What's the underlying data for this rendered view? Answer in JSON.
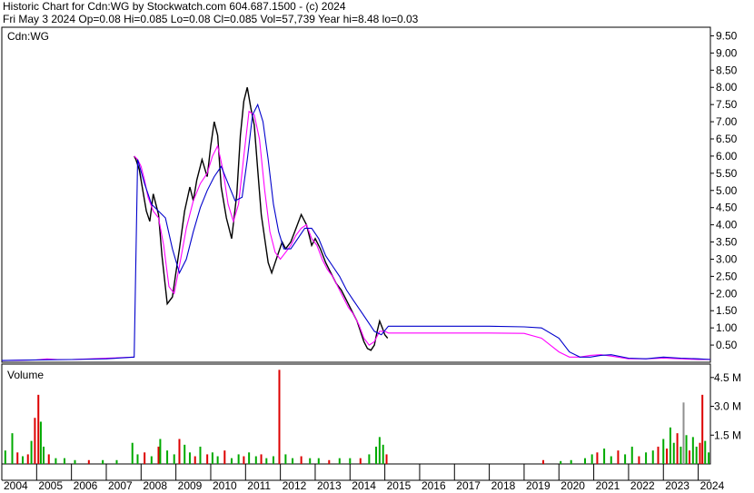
{
  "header": {
    "line1": "Historic Chart for Cdn:WG by Stockwatch.com 604.687.1500 - (c) 2024",
    "line2": "Fri May  3 2024   Op=0.08   Hi=0.085   Lo=0.08   Cl=0.085   Vol=57,739   Year hi=8.48   lo=0.03"
  },
  "chart_data": [
    {
      "type": "line",
      "title": "Cdn:WG",
      "ylim": [
        0,
        9.75
      ],
      "y_ticks": [
        "0.50",
        "1.00",
        "1.50",
        "2.00",
        "2.50",
        "3.00",
        "3.50",
        "4.00",
        "4.50",
        "5.00",
        "5.50",
        "6.00",
        "6.50",
        "7.00",
        "7.50",
        "8.00",
        "8.50",
        "9.00",
        "9.50"
      ],
      "xlim": [
        2004,
        2024.35
      ],
      "x_ticks": [
        "2004",
        "2005",
        "2006",
        "2007",
        "2008",
        "2009",
        "2010",
        "2011",
        "2012",
        "2013",
        "2014",
        "2015",
        "2016",
        "2017",
        "2018",
        "2019",
        "2020",
        "2021",
        "2022",
        "2023",
        "2024"
      ],
      "grid": false,
      "colors": {
        "price": "#000000",
        "ma_short": "#ff00ff",
        "ma_long": "#0000cc",
        "down_tick": "#cc0000"
      },
      "series": [
        {
          "x": [
            2004,
            2004.5,
            2005,
            2005.3,
            2005.6,
            2006,
            2006.5,
            2007,
            2007.8
          ],
          "values": [
            0.05,
            0.06,
            0.07,
            0.1,
            0.08,
            0.08,
            0.1,
            0.12,
            0.15
          ]
        },
        {
          "x": [
            2007.8,
            2007.85,
            2007.95,
            2008.05,
            2008.15,
            2008.25,
            2008.35,
            2008.5,
            2008.6,
            2008.75,
            2008.9,
            2009.0,
            2009.1,
            2009.25,
            2009.4,
            2009.5,
            2009.6,
            2009.75,
            2009.9,
            2010.0,
            2010.1,
            2010.2,
            2010.3,
            2010.45,
            2010.6,
            2010.75,
            2010.85,
            2010.95,
            2011.05,
            2011.15,
            2011.25,
            2011.35,
            2011.45,
            2011.55,
            2011.65,
            2011.75,
            2011.85,
            2011.95,
            2012.05,
            2012.15,
            2012.3,
            2012.45,
            2012.6,
            2012.75,
            2012.9,
            2013.0,
            2013.15,
            2013.3,
            2013.45,
            2013.6,
            2013.75,
            2013.9,
            2014.0,
            2014.1,
            2014.2,
            2014.3,
            2014.4,
            2014.5,
            2014.6,
            2014.7,
            2014.78,
            2014.85,
            2014.93,
            2015.0,
            2015.08
          ],
          "values": [
            6.0,
            5.9,
            5.6,
            5.0,
            4.4,
            4.1,
            4.9,
            4.3,
            3.1,
            1.7,
            1.9,
            2.6,
            3.3,
            4.4,
            5.1,
            4.7,
            5.3,
            5.9,
            5.4,
            6.3,
            7.0,
            6.6,
            5.1,
            4.2,
            3.6,
            4.9,
            6.6,
            7.6,
            8.0,
            7.4,
            6.9,
            5.6,
            4.3,
            3.6,
            2.9,
            2.6,
            2.9,
            3.2,
            3.5,
            3.3,
            3.5,
            3.9,
            4.3,
            4.0,
            3.4,
            3.6,
            3.3,
            2.9,
            2.6,
            2.3,
            2.1,
            1.8,
            1.6,
            1.4,
            1.2,
            0.9,
            0.6,
            0.4,
            0.35,
            0.5,
            0.9,
            1.2,
            1.0,
            0.8,
            0.7
          ]
        },
        {
          "x": [
            2007.8,
            2007.9,
            2008.0,
            2008.1,
            2008.2,
            2008.35,
            2008.5,
            2008.65,
            2008.8,
            2008.95,
            2009.1,
            2009.3,
            2009.5,
            2009.7,
            2009.9,
            2010.05,
            2010.2,
            2010.35,
            2010.5,
            2010.65,
            2010.8,
            2010.95,
            2011.1,
            2011.25,
            2011.4,
            2011.55,
            2011.7,
            2011.85,
            2012.0,
            2012.15,
            2012.3,
            2012.45,
            2012.6,
            2012.75,
            2012.9,
            2013.05,
            2013.2,
            2013.35,
            2013.5,
            2013.65,
            2013.8,
            2013.95,
            2014.1,
            2014.25,
            2014.4,
            2014.55,
            2014.7,
            2014.85,
            2015.0,
            2015.1,
            2016,
            2017,
            2018,
            2019,
            2019.5,
            2020,
            2020.3,
            2020.6,
            2020.9,
            2021.2,
            2021.5,
            2022,
            2022.5,
            2023,
            2023.5,
            2024,
            2024.35
          ],
          "values": [
            6.0,
            5.9,
            5.7,
            5.3,
            4.8,
            4.4,
            4.2,
            3.4,
            2.2,
            2.0,
            2.8,
            3.9,
            4.7,
            5.2,
            5.5,
            6.0,
            6.3,
            5.6,
            4.6,
            4.1,
            4.6,
            6.0,
            7.3,
            7.2,
            6.5,
            5.0,
            3.8,
            3.2,
            3.0,
            3.2,
            3.4,
            3.7,
            3.9,
            4.0,
            3.6,
            3.4,
            3.0,
            2.7,
            2.5,
            2.2,
            1.9,
            1.6,
            1.4,
            1.1,
            0.7,
            0.5,
            0.6,
            0.9,
            0.9,
            0.85,
            0.85,
            0.85,
            0.85,
            0.84,
            0.7,
            0.3,
            0.15,
            0.15,
            0.2,
            0.22,
            0.18,
            0.1,
            0.1,
            0.12,
            0.1,
            0.08,
            0.085
          ]
        },
        {
          "x": [
            2004,
            2005,
            2006,
            2007,
            2007.8,
            2007.9,
            2008.1,
            2008.3,
            2008.5,
            2008.7,
            2008.9,
            2009.1,
            2009.3,
            2009.5,
            2009.7,
            2009.9,
            2010.1,
            2010.3,
            2010.5,
            2010.7,
            2010.9,
            2011.05,
            2011.2,
            2011.35,
            2011.5,
            2011.65,
            2011.8,
            2011.95,
            2012.1,
            2012.3,
            2012.5,
            2012.7,
            2012.9,
            2013.1,
            2013.3,
            2013.5,
            2013.7,
            2013.9,
            2014.1,
            2014.3,
            2014.5,
            2014.7,
            2014.9,
            2015.1,
            2016,
            2017,
            2018,
            2019,
            2019.5,
            2020,
            2020.3,
            2020.6,
            2020.9,
            2021.2,
            2021.5,
            2022,
            2022.5,
            2023,
            2023.5,
            2024,
            2024.35
          ],
          "values": [
            0.05,
            0.07,
            0.08,
            0.1,
            0.15,
            5.9,
            5.2,
            4.6,
            4.4,
            4.2,
            3.3,
            2.6,
            3.0,
            3.8,
            4.5,
            5.0,
            5.4,
            5.7,
            5.2,
            4.7,
            4.8,
            5.9,
            7.2,
            7.5,
            7.0,
            5.9,
            4.6,
            3.8,
            3.3,
            3.3,
            3.6,
            3.9,
            3.9,
            3.6,
            3.1,
            2.8,
            2.5,
            2.1,
            1.8,
            1.5,
            1.2,
            0.9,
            0.8,
            1.05,
            1.05,
            1.05,
            1.05,
            1.03,
            1.0,
            0.7,
            0.3,
            0.15,
            0.15,
            0.2,
            0.22,
            0.12,
            0.1,
            0.15,
            0.12,
            0.1,
            0.08
          ]
        }
      ]
    },
    {
      "type": "bar",
      "title": "Volume",
      "ylim": [
        0,
        5.2
      ],
      "y_ticks": [
        "1.5 M",
        "3.0 M",
        "4.5 M"
      ],
      "colors": {
        "up": "#00aa00",
        "down": "#dd0000",
        "neutral": "#909090"
      },
      "bars": [
        {
          "x": 2004.1,
          "v": 0.7,
          "c": "up"
        },
        {
          "x": 2004.3,
          "v": 1.6,
          "c": "up"
        },
        {
          "x": 2004.45,
          "v": 0.6,
          "c": "down"
        },
        {
          "x": 2004.6,
          "v": 0.4,
          "c": "up"
        },
        {
          "x": 2004.75,
          "v": 0.5,
          "c": "down"
        },
        {
          "x": 2004.85,
          "v": 1.2,
          "c": "up"
        },
        {
          "x": 2004.95,
          "v": 2.4,
          "c": "down"
        },
        {
          "x": 2005.05,
          "v": 3.6,
          "c": "down"
        },
        {
          "x": 2005.12,
          "v": 2.2,
          "c": "up"
        },
        {
          "x": 2005.2,
          "v": 0.9,
          "c": "up"
        },
        {
          "x": 2005.35,
          "v": 0.5,
          "c": "down"
        },
        {
          "x": 2005.55,
          "v": 0.3,
          "c": "up"
        },
        {
          "x": 2005.8,
          "v": 0.3,
          "c": "up"
        },
        {
          "x": 2006.1,
          "v": 0.2,
          "c": "up"
        },
        {
          "x": 2006.5,
          "v": 0.2,
          "c": "down"
        },
        {
          "x": 2006.9,
          "v": 0.2,
          "c": "up"
        },
        {
          "x": 2007.3,
          "v": 0.2,
          "c": "up"
        },
        {
          "x": 2007.75,
          "v": 1.1,
          "c": "up"
        },
        {
          "x": 2007.9,
          "v": 0.5,
          "c": "up"
        },
        {
          "x": 2008.1,
          "v": 0.6,
          "c": "down"
        },
        {
          "x": 2008.3,
          "v": 0.4,
          "c": "up"
        },
        {
          "x": 2008.5,
          "v": 0.9,
          "c": "down"
        },
        {
          "x": 2008.55,
          "v": 1.3,
          "c": "up"
        },
        {
          "x": 2008.75,
          "v": 0.7,
          "c": "up"
        },
        {
          "x": 2008.95,
          "v": 0.5,
          "c": "up"
        },
        {
          "x": 2009.1,
          "v": 1.3,
          "c": "down"
        },
        {
          "x": 2009.25,
          "v": 1.0,
          "c": "up"
        },
        {
          "x": 2009.4,
          "v": 0.6,
          "c": "up"
        },
        {
          "x": 2009.55,
          "v": 0.4,
          "c": "down"
        },
        {
          "x": 2009.7,
          "v": 0.9,
          "c": "up"
        },
        {
          "x": 2009.9,
          "v": 0.5,
          "c": "down"
        },
        {
          "x": 2010.05,
          "v": 0.6,
          "c": "up"
        },
        {
          "x": 2010.2,
          "v": 0.4,
          "c": "up"
        },
        {
          "x": 2010.4,
          "v": 0.7,
          "c": "down"
        },
        {
          "x": 2010.6,
          "v": 0.3,
          "c": "up"
        },
        {
          "x": 2010.8,
          "v": 0.5,
          "c": "up"
        },
        {
          "x": 2010.95,
          "v": 0.4,
          "c": "down"
        },
        {
          "x": 2011.1,
          "v": 0.6,
          "c": "up"
        },
        {
          "x": 2011.3,
          "v": 0.4,
          "c": "up"
        },
        {
          "x": 2011.45,
          "v": 0.5,
          "c": "down"
        },
        {
          "x": 2011.6,
          "v": 0.3,
          "c": "up"
        },
        {
          "x": 2011.8,
          "v": 0.4,
          "c": "up"
        },
        {
          "x": 2011.97,
          "v": 4.9,
          "c": "down"
        },
        {
          "x": 2012.15,
          "v": 0.5,
          "c": "up"
        },
        {
          "x": 2012.35,
          "v": 0.3,
          "c": "up"
        },
        {
          "x": 2012.6,
          "v": 0.4,
          "c": "down"
        },
        {
          "x": 2012.85,
          "v": 0.3,
          "c": "up"
        },
        {
          "x": 2013.1,
          "v": 0.3,
          "c": "up"
        },
        {
          "x": 2013.4,
          "v": 0.2,
          "c": "down"
        },
        {
          "x": 2013.7,
          "v": 0.3,
          "c": "up"
        },
        {
          "x": 2014.0,
          "v": 0.3,
          "c": "up"
        },
        {
          "x": 2014.3,
          "v": 0.3,
          "c": "down"
        },
        {
          "x": 2014.55,
          "v": 0.5,
          "c": "up"
        },
        {
          "x": 2014.75,
          "v": 0.9,
          "c": "up"
        },
        {
          "x": 2014.85,
          "v": 1.4,
          "c": "up"
        },
        {
          "x": 2014.95,
          "v": 1.0,
          "c": "up"
        },
        {
          "x": 2015.05,
          "v": 0.5,
          "c": "down"
        },
        {
          "x": 2019.55,
          "v": 0.2,
          "c": "down"
        },
        {
          "x": 2020.05,
          "v": 0.15,
          "c": "up"
        },
        {
          "x": 2020.35,
          "v": 0.2,
          "c": "up"
        },
        {
          "x": 2020.75,
          "v": 0.3,
          "c": "up"
        },
        {
          "x": 2020.95,
          "v": 0.5,
          "c": "up"
        },
        {
          "x": 2021.1,
          "v": 0.6,
          "c": "down"
        },
        {
          "x": 2021.3,
          "v": 0.8,
          "c": "up"
        },
        {
          "x": 2021.5,
          "v": 0.4,
          "c": "up"
        },
        {
          "x": 2021.7,
          "v": 0.7,
          "c": "down"
        },
        {
          "x": 2021.9,
          "v": 0.5,
          "c": "up"
        },
        {
          "x": 2022.1,
          "v": 0.9,
          "c": "up"
        },
        {
          "x": 2022.3,
          "v": 0.4,
          "c": "down"
        },
        {
          "x": 2022.5,
          "v": 0.6,
          "c": "up"
        },
        {
          "x": 2022.7,
          "v": 0.7,
          "c": "up"
        },
        {
          "x": 2022.85,
          "v": 0.9,
          "c": "down"
        },
        {
          "x": 2023.0,
          "v": 1.3,
          "c": "up"
        },
        {
          "x": 2023.1,
          "v": 0.8,
          "c": "down"
        },
        {
          "x": 2023.2,
          "v": 1.9,
          "c": "up"
        },
        {
          "x": 2023.3,
          "v": 1.1,
          "c": "up"
        },
        {
          "x": 2023.4,
          "v": 1.6,
          "c": "down"
        },
        {
          "x": 2023.5,
          "v": 0.9,
          "c": "up"
        },
        {
          "x": 2023.58,
          "v": 3.2,
          "c": "neutral"
        },
        {
          "x": 2023.66,
          "v": 1.5,
          "c": "up"
        },
        {
          "x": 2023.75,
          "v": 0.7,
          "c": "down"
        },
        {
          "x": 2023.85,
          "v": 1.4,
          "c": "up"
        },
        {
          "x": 2023.95,
          "v": 0.9,
          "c": "up"
        },
        {
          "x": 2024.05,
          "v": 1.1,
          "c": "down"
        },
        {
          "x": 2024.12,
          "v": 3.6,
          "c": "down"
        },
        {
          "x": 2024.2,
          "v": 1.2,
          "c": "up"
        },
        {
          "x": 2024.3,
          "v": 0.6,
          "c": "up"
        }
      ]
    }
  ]
}
